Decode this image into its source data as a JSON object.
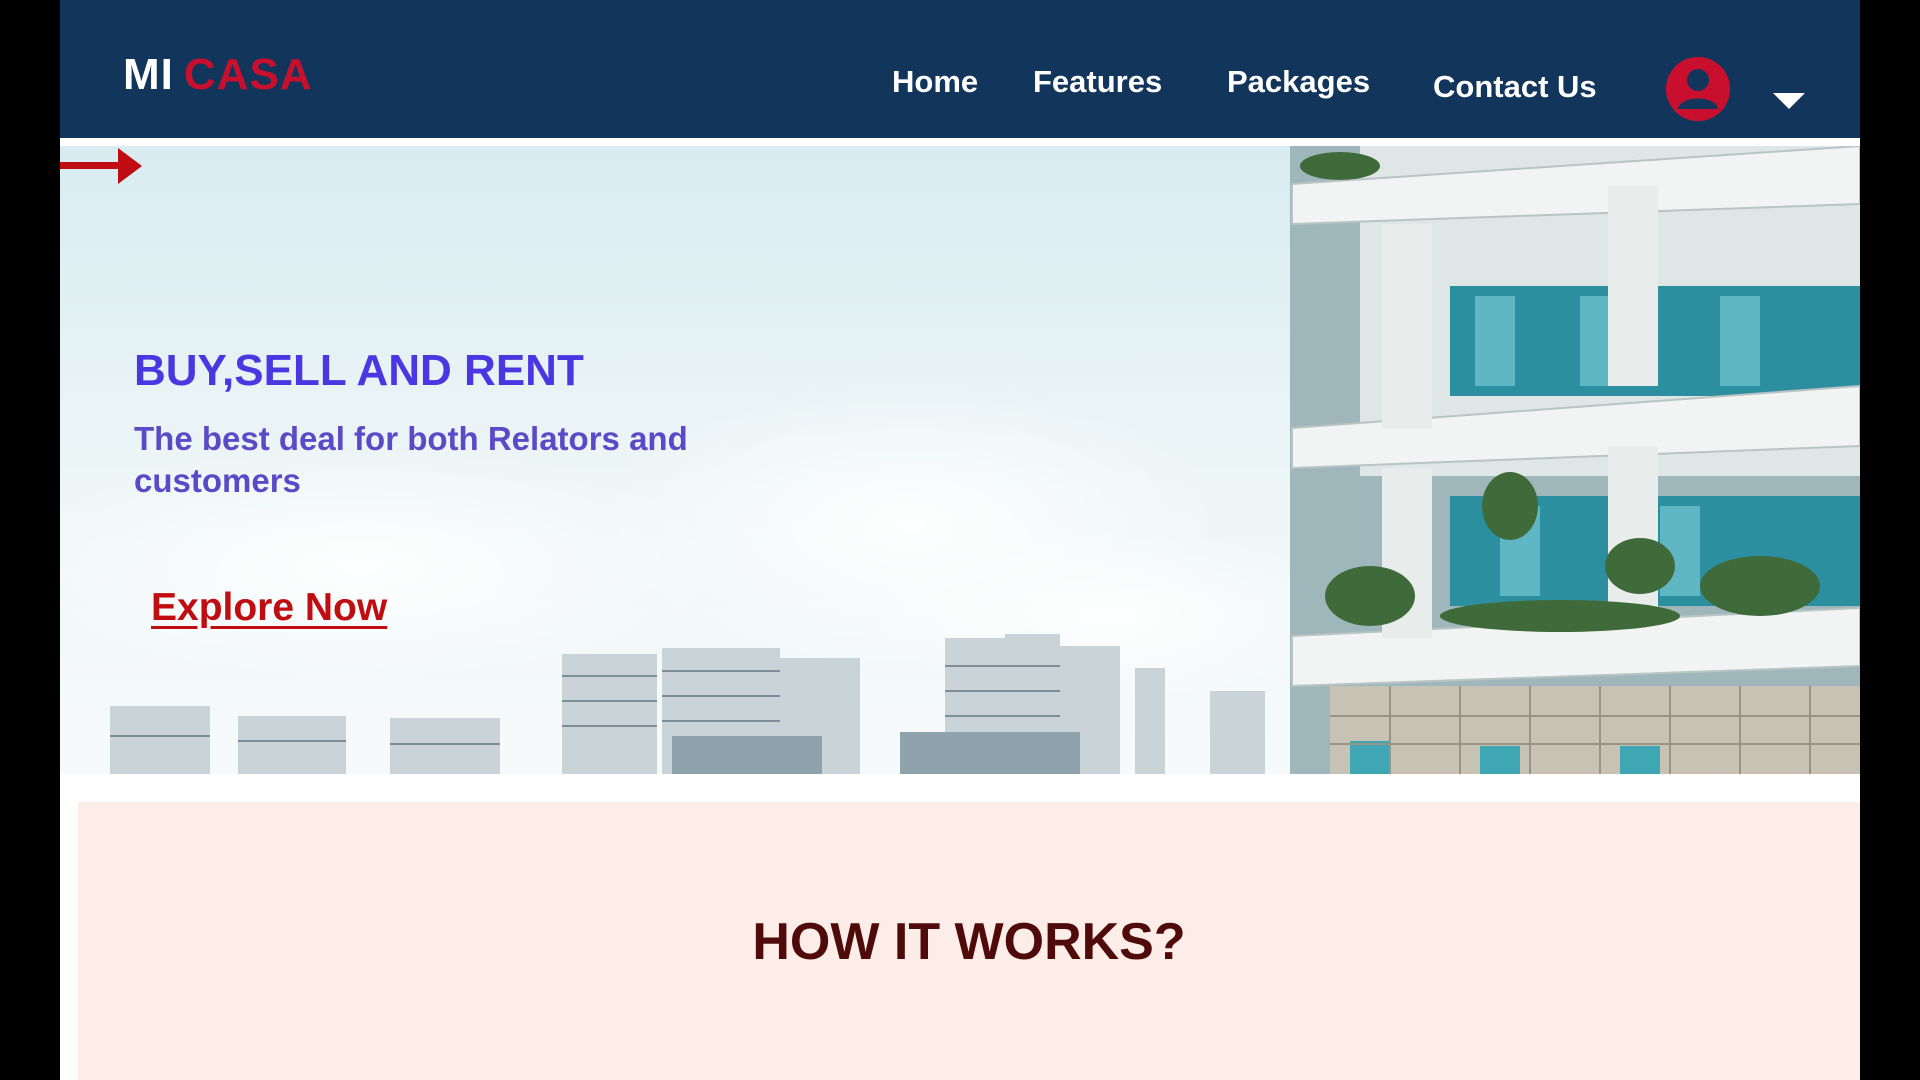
{
  "brand": {
    "part1": "MI",
    "part2": "CASA"
  },
  "nav": {
    "items": [
      {
        "label": "Home"
      },
      {
        "label": "Features"
      },
      {
        "label": "Packages"
      },
      {
        "label": "Contact Us"
      }
    ],
    "user_icon": "user-avatar-icon",
    "dropdown_icon": "chevron-down-icon"
  },
  "hero": {
    "title": "BUY,SELL AND RENT",
    "subtitle": "The best deal for both Relators and customers",
    "cta": "Explore Now",
    "cta_icon": "arrow-right-icon"
  },
  "how": {
    "title": "HOW IT WORKS?"
  },
  "colors": {
    "header_bg": "#11355b",
    "brand_accent": "#c8102e",
    "hero_title": "#4b37e2",
    "cta": "#c00d12",
    "section_bg": "#fdede8",
    "section_title": "#4f0a0a"
  }
}
